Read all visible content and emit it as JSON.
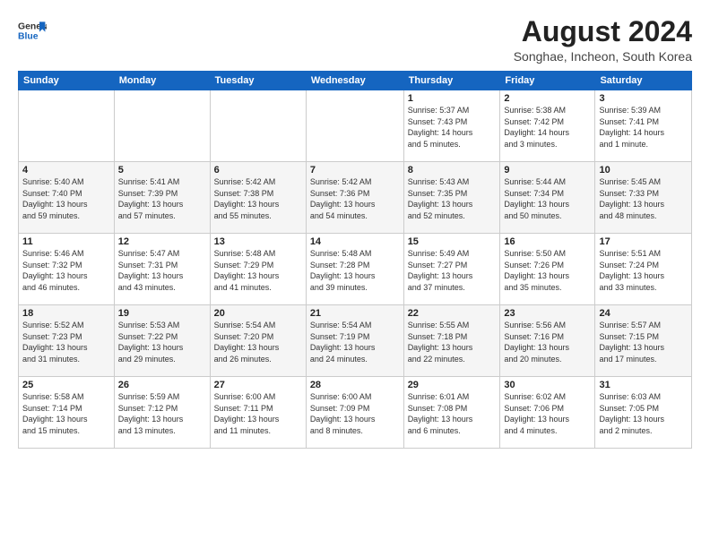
{
  "logo": {
    "general": "General",
    "blue": "Blue"
  },
  "title": {
    "month": "August 2024",
    "location": "Songhae, Incheon, South Korea"
  },
  "days_header": [
    "Sunday",
    "Monday",
    "Tuesday",
    "Wednesday",
    "Thursday",
    "Friday",
    "Saturday"
  ],
  "weeks": [
    [
      {
        "day": "",
        "info": ""
      },
      {
        "day": "",
        "info": ""
      },
      {
        "day": "",
        "info": ""
      },
      {
        "day": "",
        "info": ""
      },
      {
        "day": "1",
        "info": "Sunrise: 5:37 AM\nSunset: 7:43 PM\nDaylight: 14 hours\nand 5 minutes."
      },
      {
        "day": "2",
        "info": "Sunrise: 5:38 AM\nSunset: 7:42 PM\nDaylight: 14 hours\nand 3 minutes."
      },
      {
        "day": "3",
        "info": "Sunrise: 5:39 AM\nSunset: 7:41 PM\nDaylight: 14 hours\nand 1 minute."
      }
    ],
    [
      {
        "day": "4",
        "info": "Sunrise: 5:40 AM\nSunset: 7:40 PM\nDaylight: 13 hours\nand 59 minutes."
      },
      {
        "day": "5",
        "info": "Sunrise: 5:41 AM\nSunset: 7:39 PM\nDaylight: 13 hours\nand 57 minutes."
      },
      {
        "day": "6",
        "info": "Sunrise: 5:42 AM\nSunset: 7:38 PM\nDaylight: 13 hours\nand 55 minutes."
      },
      {
        "day": "7",
        "info": "Sunrise: 5:42 AM\nSunset: 7:36 PM\nDaylight: 13 hours\nand 54 minutes."
      },
      {
        "day": "8",
        "info": "Sunrise: 5:43 AM\nSunset: 7:35 PM\nDaylight: 13 hours\nand 52 minutes."
      },
      {
        "day": "9",
        "info": "Sunrise: 5:44 AM\nSunset: 7:34 PM\nDaylight: 13 hours\nand 50 minutes."
      },
      {
        "day": "10",
        "info": "Sunrise: 5:45 AM\nSunset: 7:33 PM\nDaylight: 13 hours\nand 48 minutes."
      }
    ],
    [
      {
        "day": "11",
        "info": "Sunrise: 5:46 AM\nSunset: 7:32 PM\nDaylight: 13 hours\nand 46 minutes."
      },
      {
        "day": "12",
        "info": "Sunrise: 5:47 AM\nSunset: 7:31 PM\nDaylight: 13 hours\nand 43 minutes."
      },
      {
        "day": "13",
        "info": "Sunrise: 5:48 AM\nSunset: 7:29 PM\nDaylight: 13 hours\nand 41 minutes."
      },
      {
        "day": "14",
        "info": "Sunrise: 5:48 AM\nSunset: 7:28 PM\nDaylight: 13 hours\nand 39 minutes."
      },
      {
        "day": "15",
        "info": "Sunrise: 5:49 AM\nSunset: 7:27 PM\nDaylight: 13 hours\nand 37 minutes."
      },
      {
        "day": "16",
        "info": "Sunrise: 5:50 AM\nSunset: 7:26 PM\nDaylight: 13 hours\nand 35 minutes."
      },
      {
        "day": "17",
        "info": "Sunrise: 5:51 AM\nSunset: 7:24 PM\nDaylight: 13 hours\nand 33 minutes."
      }
    ],
    [
      {
        "day": "18",
        "info": "Sunrise: 5:52 AM\nSunset: 7:23 PM\nDaylight: 13 hours\nand 31 minutes."
      },
      {
        "day": "19",
        "info": "Sunrise: 5:53 AM\nSunset: 7:22 PM\nDaylight: 13 hours\nand 29 minutes."
      },
      {
        "day": "20",
        "info": "Sunrise: 5:54 AM\nSunset: 7:20 PM\nDaylight: 13 hours\nand 26 minutes."
      },
      {
        "day": "21",
        "info": "Sunrise: 5:54 AM\nSunset: 7:19 PM\nDaylight: 13 hours\nand 24 minutes."
      },
      {
        "day": "22",
        "info": "Sunrise: 5:55 AM\nSunset: 7:18 PM\nDaylight: 13 hours\nand 22 minutes."
      },
      {
        "day": "23",
        "info": "Sunrise: 5:56 AM\nSunset: 7:16 PM\nDaylight: 13 hours\nand 20 minutes."
      },
      {
        "day": "24",
        "info": "Sunrise: 5:57 AM\nSunset: 7:15 PM\nDaylight: 13 hours\nand 17 minutes."
      }
    ],
    [
      {
        "day": "25",
        "info": "Sunrise: 5:58 AM\nSunset: 7:14 PM\nDaylight: 13 hours\nand 15 minutes."
      },
      {
        "day": "26",
        "info": "Sunrise: 5:59 AM\nSunset: 7:12 PM\nDaylight: 13 hours\nand 13 minutes."
      },
      {
        "day": "27",
        "info": "Sunrise: 6:00 AM\nSunset: 7:11 PM\nDaylight: 13 hours\nand 11 minutes."
      },
      {
        "day": "28",
        "info": "Sunrise: 6:00 AM\nSunset: 7:09 PM\nDaylight: 13 hours\nand 8 minutes."
      },
      {
        "day": "29",
        "info": "Sunrise: 6:01 AM\nSunset: 7:08 PM\nDaylight: 13 hours\nand 6 minutes."
      },
      {
        "day": "30",
        "info": "Sunrise: 6:02 AM\nSunset: 7:06 PM\nDaylight: 13 hours\nand 4 minutes."
      },
      {
        "day": "31",
        "info": "Sunrise: 6:03 AM\nSunset: 7:05 PM\nDaylight: 13 hours\nand 2 minutes."
      }
    ]
  ]
}
